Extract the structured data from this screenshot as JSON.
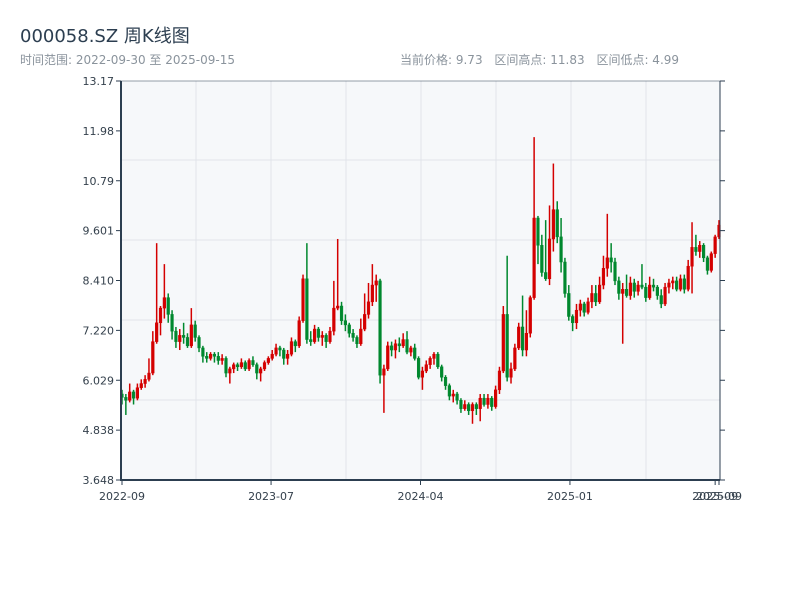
{
  "header": {
    "title": "000058.SZ 周K线图",
    "range_label": "时间范围: 2022-09-30 至 2025-09-15",
    "current_price": "当前价格: 9.73",
    "range_high": "区间高点: 11.83",
    "range_low": "区间低点: 4.99"
  },
  "colors": {
    "up": "#d40000",
    "down": "#00882e",
    "axis": "#2c3e50",
    "grid": "#e1e4ea",
    "plot_bg": "#f6f8fa"
  },
  "chart_data": {
    "type": "candlestick",
    "title": "000058.SZ 周K线图",
    "xlabel": "",
    "ylabel": "",
    "ylim": [
      3.648,
      13.17
    ],
    "y_ticks": [
      "3.648",
      "4.838",
      "6.029",
      "7.220",
      "8.410",
      "9.601",
      "10.79",
      "11.98",
      "13.17"
    ],
    "x_ticks": [
      "2022-09",
      "2023-07",
      "2024-04",
      "2025-01",
      "2025-09",
      "2025-09"
    ],
    "grid": true,
    "ohlc_fields": [
      "open",
      "high",
      "low",
      "close"
    ],
    "ohlc": [
      [
        5.7,
        5.8,
        5.45,
        5.62
      ],
      [
        5.62,
        5.7,
        5.2,
        5.55
      ],
      [
        5.55,
        5.95,
        5.5,
        5.75
      ],
      [
        5.75,
        5.8,
        5.45,
        5.6
      ],
      [
        5.6,
        5.95,
        5.55,
        5.85
      ],
      [
        5.85,
        6.05,
        5.8,
        5.95
      ],
      [
        5.95,
        6.15,
        5.85,
        6.05
      ],
      [
        6.05,
        6.55,
        6.0,
        6.2
      ],
      [
        6.2,
        7.2,
        6.15,
        6.95
      ],
      [
        6.95,
        9.3,
        6.9,
        7.4
      ],
      [
        7.4,
        7.8,
        7.1,
        7.75
      ],
      [
        7.75,
        8.8,
        7.5,
        8.0
      ],
      [
        8.0,
        8.1,
        7.4,
        7.6
      ],
      [
        7.6,
        7.7,
        7.0,
        7.2
      ],
      [
        7.2,
        7.3,
        6.8,
        6.95
      ],
      [
        6.95,
        7.25,
        6.75,
        7.1
      ],
      [
        7.1,
        7.4,
        6.9,
        7.05
      ],
      [
        7.05,
        7.15,
        6.8,
        6.85
      ],
      [
        6.85,
        7.75,
        6.8,
        7.35
      ],
      [
        7.35,
        7.45,
        6.95,
        7.05
      ],
      [
        7.05,
        7.1,
        6.7,
        6.8
      ],
      [
        6.8,
        6.85,
        6.45,
        6.6
      ],
      [
        6.6,
        6.7,
        6.45,
        6.55
      ],
      [
        6.55,
        6.7,
        6.5,
        6.65
      ],
      [
        6.65,
        6.7,
        6.45,
        6.6
      ],
      [
        6.6,
        6.7,
        6.4,
        6.5
      ],
      [
        6.5,
        6.65,
        6.4,
        6.55
      ],
      [
        6.55,
        6.6,
        6.1,
        6.2
      ],
      [
        6.2,
        6.35,
        5.95,
        6.3
      ],
      [
        6.3,
        6.45,
        6.2,
        6.4
      ],
      [
        6.4,
        6.45,
        6.25,
        6.35
      ],
      [
        6.35,
        6.55,
        6.3,
        6.45
      ],
      [
        6.45,
        6.5,
        6.25,
        6.3
      ],
      [
        6.3,
        6.55,
        6.25,
        6.5
      ],
      [
        6.5,
        6.6,
        6.35,
        6.4
      ],
      [
        6.4,
        6.45,
        6.05,
        6.2
      ],
      [
        6.2,
        6.35,
        6.0,
        6.3
      ],
      [
        6.3,
        6.5,
        6.25,
        6.45
      ],
      [
        6.45,
        6.6,
        6.4,
        6.55
      ],
      [
        6.55,
        6.75,
        6.5,
        6.65
      ],
      [
        6.65,
        6.9,
        6.6,
        6.8
      ],
      [
        6.8,
        6.85,
        6.6,
        6.75
      ],
      [
        6.75,
        6.8,
        6.4,
        6.55
      ],
      [
        6.55,
        6.75,
        6.4,
        6.65
      ],
      [
        6.65,
        7.05,
        6.6,
        6.95
      ],
      [
        6.95,
        7.0,
        6.7,
        6.85
      ],
      [
        6.85,
        7.55,
        6.8,
        7.45
      ],
      [
        7.45,
        8.55,
        7.4,
        8.45
      ],
      [
        8.45,
        9.3,
        6.9,
        7.0
      ],
      [
        7.0,
        7.2,
        6.85,
        6.95
      ],
      [
        6.95,
        7.35,
        6.9,
        7.25
      ],
      [
        7.25,
        7.3,
        6.95,
        7.05
      ],
      [
        7.05,
        7.2,
        6.85,
        7.1
      ],
      [
        7.1,
        7.15,
        6.8,
        6.95
      ],
      [
        6.95,
        7.3,
        6.9,
        7.2
      ],
      [
        7.2,
        8.4,
        7.1,
        7.75
      ],
      [
        7.75,
        9.4,
        7.7,
        7.8
      ],
      [
        7.8,
        7.9,
        7.35,
        7.45
      ],
      [
        7.45,
        7.6,
        7.2,
        7.35
      ],
      [
        7.35,
        7.4,
        7.05,
        7.15
      ],
      [
        7.15,
        7.25,
        6.95,
        7.05
      ],
      [
        7.05,
        7.1,
        6.8,
        6.9
      ],
      [
        6.9,
        7.5,
        6.85,
        7.25
      ],
      [
        7.25,
        8.1,
        7.2,
        7.6
      ],
      [
        7.6,
        8.35,
        7.5,
        7.9
      ],
      [
        7.9,
        8.8,
        7.8,
        8.3
      ],
      [
        8.3,
        8.55,
        7.9,
        8.4
      ],
      [
        8.4,
        8.45,
        5.95,
        6.15
      ],
      [
        6.15,
        6.4,
        5.25,
        6.3
      ],
      [
        6.3,
        6.95,
        6.25,
        6.85
      ],
      [
        6.85,
        6.95,
        6.6,
        6.75
      ],
      [
        6.75,
        7.0,
        6.55,
        6.9
      ],
      [
        6.9,
        7.05,
        6.7,
        6.85
      ],
      [
        6.85,
        7.15,
        6.8,
        7.0
      ],
      [
        7.0,
        7.2,
        6.65,
        6.7
      ],
      [
        6.7,
        6.85,
        6.6,
        6.8
      ],
      [
        6.8,
        6.9,
        6.5,
        6.55
      ],
      [
        6.55,
        6.6,
        6.05,
        6.1
      ],
      [
        6.1,
        6.35,
        5.8,
        6.25
      ],
      [
        6.25,
        6.5,
        6.2,
        6.4
      ],
      [
        6.4,
        6.6,
        6.3,
        6.55
      ],
      [
        6.55,
        6.7,
        6.4,
        6.65
      ],
      [
        6.65,
        6.7,
        6.3,
        6.35
      ],
      [
        6.35,
        6.4,
        6.0,
        6.1
      ],
      [
        6.1,
        6.15,
        5.8,
        5.9
      ],
      [
        5.9,
        5.95,
        5.55,
        5.65
      ],
      [
        5.65,
        5.8,
        5.5,
        5.7
      ],
      [
        5.7,
        5.75,
        5.45,
        5.55
      ],
      [
        5.55,
        5.6,
        5.25,
        5.35
      ],
      [
        5.35,
        5.55,
        5.3,
        5.45
      ],
      [
        5.45,
        5.5,
        5.2,
        5.3
      ],
      [
        5.3,
        5.5,
        4.99,
        5.45
      ],
      [
        5.45,
        5.5,
        5.2,
        5.35
      ],
      [
        5.35,
        5.7,
        5.05,
        5.6
      ],
      [
        5.6,
        5.7,
        5.4,
        5.45
      ],
      [
        5.45,
        5.7,
        5.35,
        5.6
      ],
      [
        5.6,
        5.65,
        5.3,
        5.4
      ],
      [
        5.4,
        5.9,
        5.35,
        5.8
      ],
      [
        5.8,
        6.35,
        5.7,
        6.25
      ],
      [
        6.25,
        7.8,
        6.2,
        7.6
      ],
      [
        7.6,
        9.0,
        6.0,
        6.1
      ],
      [
        6.1,
        6.45,
        5.95,
        6.3
      ],
      [
        6.3,
        6.9,
        6.25,
        6.8
      ],
      [
        6.8,
        7.4,
        6.75,
        7.3
      ],
      [
        7.3,
        8.05,
        6.6,
        6.75
      ],
      [
        6.75,
        7.7,
        6.6,
        7.15
      ],
      [
        7.15,
        8.05,
        7.05,
        8.0
      ],
      [
        8.0,
        11.83,
        7.95,
        9.9
      ],
      [
        9.9,
        9.95,
        8.8,
        9.25
      ],
      [
        9.25,
        9.5,
        8.5,
        8.6
      ],
      [
        8.6,
        9.85,
        8.4,
        8.45
      ],
      [
        8.45,
        10.2,
        8.3,
        9.4
      ],
      [
        9.4,
        11.2,
        9.1,
        10.1
      ],
      [
        10.1,
        10.3,
        9.3,
        9.45
      ],
      [
        9.45,
        9.9,
        8.6,
        8.85
      ],
      [
        8.85,
        8.95,
        8.0,
        8.1
      ],
      [
        8.1,
        8.3,
        7.45,
        7.55
      ],
      [
        7.55,
        7.6,
        7.2,
        7.4
      ],
      [
        7.4,
        7.85,
        7.25,
        7.7
      ],
      [
        7.7,
        7.95,
        7.55,
        7.85
      ],
      [
        7.85,
        7.9,
        7.55,
        7.65
      ],
      [
        7.65,
        8.0,
        7.6,
        7.9
      ],
      [
        7.9,
        8.3,
        7.75,
        8.1
      ],
      [
        8.1,
        8.3,
        7.8,
        7.9
      ],
      [
        7.9,
        8.5,
        7.85,
        8.3
      ],
      [
        8.3,
        9.0,
        8.2,
        8.7
      ],
      [
        8.7,
        10.0,
        8.5,
        8.95
      ],
      [
        8.95,
        9.3,
        8.6,
        8.85
      ],
      [
        8.85,
        8.95,
        8.3,
        8.4
      ],
      [
        8.4,
        8.5,
        7.95,
        8.1
      ],
      [
        8.1,
        8.35,
        6.9,
        8.2
      ],
      [
        8.2,
        8.55,
        8.0,
        8.05
      ],
      [
        8.05,
        8.5,
        7.95,
        8.35
      ],
      [
        8.35,
        8.45,
        8.0,
        8.15
      ],
      [
        8.15,
        8.4,
        8.05,
        8.3
      ],
      [
        8.3,
        8.8,
        8.2,
        8.25
      ],
      [
        8.25,
        8.35,
        7.9,
        8.0
      ],
      [
        8.0,
        8.5,
        7.95,
        8.3
      ],
      [
        8.3,
        8.45,
        8.15,
        8.25
      ],
      [
        8.25,
        8.3,
        7.95,
        8.05
      ],
      [
        8.05,
        8.2,
        7.75,
        7.85
      ],
      [
        7.85,
        8.35,
        7.8,
        8.25
      ],
      [
        8.25,
        8.45,
        8.1,
        8.35
      ],
      [
        8.35,
        8.5,
        8.2,
        8.4
      ],
      [
        8.4,
        8.5,
        8.15,
        8.2
      ],
      [
        8.2,
        8.55,
        8.15,
        8.45
      ],
      [
        8.45,
        8.55,
        8.1,
        8.2
      ],
      [
        8.2,
        8.9,
        8.15,
        8.75
      ],
      [
        8.75,
        9.8,
        8.1,
        9.2
      ],
      [
        9.2,
        9.5,
        9.0,
        9.1
      ],
      [
        9.1,
        9.35,
        8.95,
        9.25
      ],
      [
        9.25,
        9.3,
        8.85,
        8.95
      ],
      [
        8.95,
        9.0,
        8.55,
        8.65
      ],
      [
        8.65,
        9.1,
        8.6,
        9.05
      ],
      [
        9.05,
        9.5,
        8.95,
        9.45
      ],
      [
        9.45,
        9.85,
        9.4,
        9.73
      ]
    ]
  }
}
